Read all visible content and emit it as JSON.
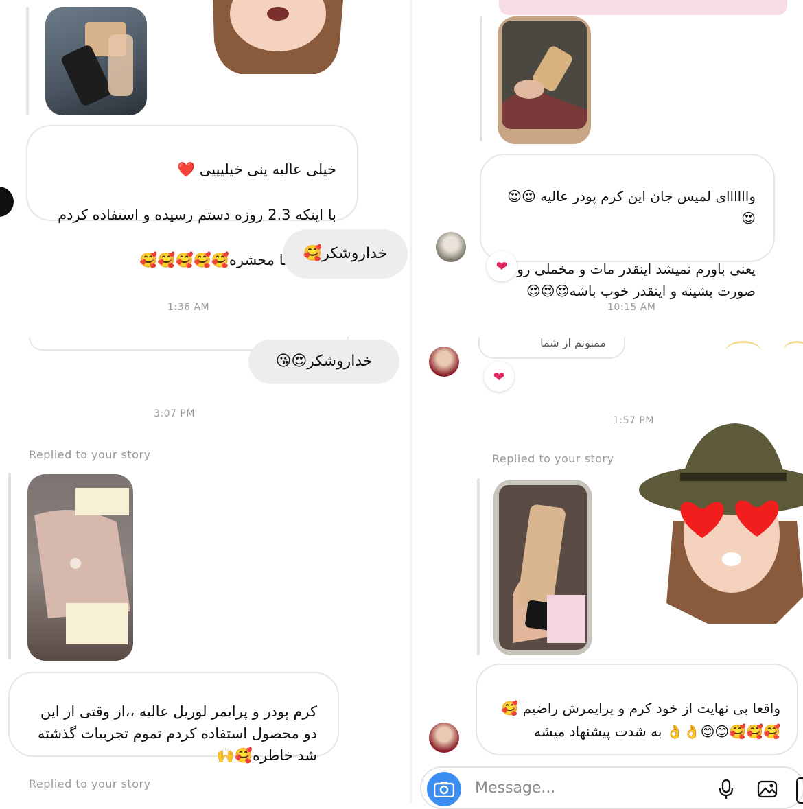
{
  "panel_tl": {
    "message_1_lines": [
      "خیلی عالیه ینی خیلیییی ❤️",
      "با اینکه 2.3 روزه دستم رسیده و استفاده کردم",
      "ولی واقعا محشره🥰🥰🥰🥰🥰"
    ],
    "reply_out": "خداروشکر🥰",
    "timestamp": "1:36 AM"
  },
  "panel_tr": {
    "message_1": "واااااای لمیس جان این کرم پودر عالیه 😍😍😍",
    "message_2": "یعنی باورم نمیشد اینقدر مات و مخملی رو صورت بشینه و اینقدر خوب باشه😍😍😍",
    "timestamp": "10:15 AM"
  },
  "panel_bl": {
    "reply_out": "خداروشکر😍😘",
    "timestamp": "3:07 PM",
    "replied_label": "Replied to your story",
    "message_1": "کرم پودر و پرایمر لوریل عالیه ،،از وقتی از این دو محصول استفاده کردم تموم تجربیات گذشته شد خاطره🥰🙌",
    "replied_label_2": "Replied to your story"
  },
  "panel_br": {
    "partial_text": "ممنونم از شما",
    "timestamp": "1:57 PM",
    "replied_label": "Replied to your story",
    "message_1": "واقعا بی نهایت از خود کرم و پرایمرش راضیم 🥰🥰🥰🥰😊😊👌👌 به شدت پیشنهاد میشه"
  },
  "composer": {
    "placeholder": "Message...",
    "icons": [
      "camera-icon",
      "microphone-icon",
      "gallery-icon"
    ]
  },
  "colors": {
    "accent_blue": "#3b8ef0",
    "bubble_border": "#e6e6e6",
    "bubble_out": "#ededed",
    "heart": "#e0245e",
    "meta_gray": "#9a9a9a"
  }
}
